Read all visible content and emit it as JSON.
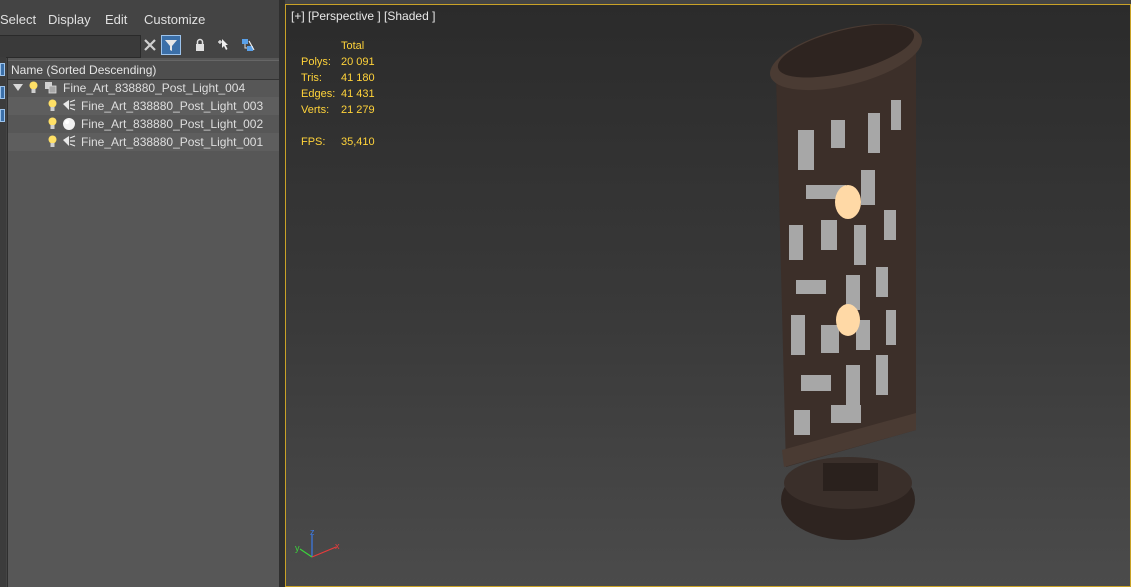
{
  "menu": {
    "select": "Select",
    "display": "Display",
    "edit": "Edit",
    "customize": "Customize"
  },
  "search": {
    "value": ""
  },
  "explorer": {
    "column_header": "Name (Sorted Descending)",
    "rows": [
      {
        "label": "Fine_Art_838880_Post_Light_004",
        "icon": "group-icon"
      },
      {
        "label": "Fine_Art_838880_Post_Light_003",
        "icon": "spot-light-icon"
      },
      {
        "label": "Fine_Art_838880_Post_Light_002",
        "icon": "omni-light-icon"
      },
      {
        "label": "Fine_Art_838880_Post_Light_001",
        "icon": "spot-light-icon"
      }
    ]
  },
  "viewport": {
    "label": "[+] [Perspective ] [Shaded ]",
    "stats": {
      "header": "Total",
      "polys_label": "Polys:",
      "polys": "20 091",
      "tris_label": "Tris:",
      "tris": "41 180",
      "edges_label": "Edges:",
      "edges": "41 431",
      "verts_label": "Verts:",
      "verts": "21 279",
      "fps_label": "FPS:",
      "fps": "35,410"
    },
    "gizmo": {
      "x": "x",
      "y": "y",
      "z": "z"
    }
  },
  "colors": {
    "stats_text": "#ffd33a",
    "viewport_border": "#c9a227",
    "lamp_metal": "#3c2f29",
    "bulb_glow": "#ffd9a6",
    "selection_blue": "#3b6fa8"
  }
}
